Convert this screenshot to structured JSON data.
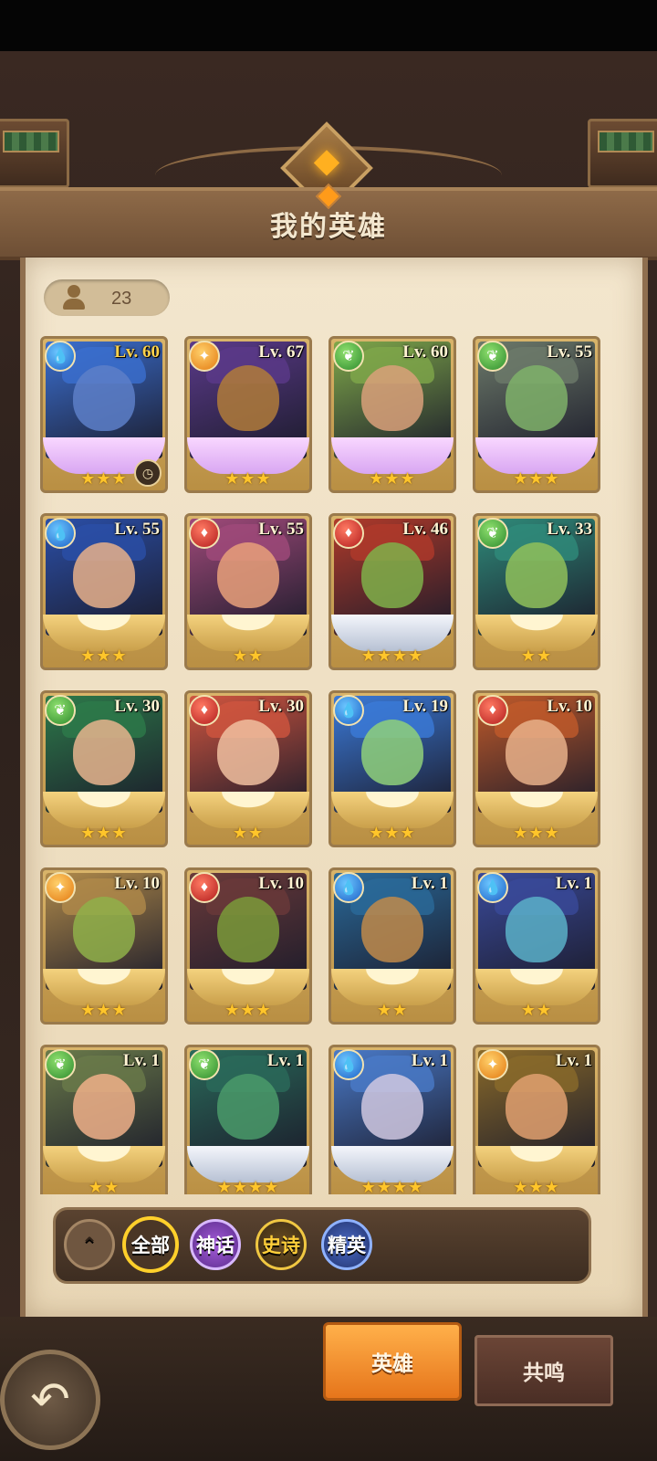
{
  "title": "我的英雄",
  "hero_count": "23",
  "filters": {
    "all": "全部",
    "myth": "神话",
    "epic": "史诗",
    "elite": "精英"
  },
  "tabs": {
    "heroes": "英雄",
    "resonance": "共鸣"
  },
  "heroes": [
    {
      "level": "Lv. 60",
      "element": "water",
      "stars": "★★★",
      "color": "#3b6fd0",
      "skin": "#5d7fc8"
    },
    {
      "level": "Lv. 67",
      "element": "light",
      "stars": "★★★",
      "color": "#5b3a8a",
      "skin": "#b07b3a"
    },
    {
      "level": "Lv. 60",
      "element": "nature",
      "stars": "★★★",
      "color": "#7fa84a",
      "skin": "#d9a07a"
    },
    {
      "level": "Lv. 55",
      "element": "nature",
      "stars": "★★★",
      "color": "#6d7a6a",
      "skin": "#7fb26a"
    },
    {
      "level": "Lv. 55",
      "element": "water",
      "stars": "★★★",
      "color": "#2b4fa8",
      "skin": "#e7b08a"
    },
    {
      "level": "Lv. 55",
      "element": "fire",
      "stars": "★★",
      "color": "#a04a7a",
      "skin": "#e7a07a"
    },
    {
      "level": "Lv. 46",
      "element": "fire",
      "stars": "★★★★",
      "color": "#b03a2a",
      "skin": "#7fb04a"
    },
    {
      "level": "Lv. 33",
      "element": "nature",
      "stars": "★★",
      "color": "#2f8b7a",
      "skin": "#8fbf5a"
    },
    {
      "level": "Lv. 30",
      "element": "nature",
      "stars": "★★★",
      "color": "#2d7a4a",
      "skin": "#e8b48e"
    },
    {
      "level": "Lv. 30",
      "element": "fire",
      "stars": "★★",
      "color": "#d0553f",
      "skin": "#f0c0a0"
    },
    {
      "level": "Lv. 19",
      "element": "water",
      "stars": "★★★",
      "color": "#3b7ad8",
      "skin": "#8fd07a"
    },
    {
      "level": "Lv. 10",
      "element": "fire",
      "stars": "★★★",
      "color": "#c05a2a",
      "skin": "#e8b08a"
    },
    {
      "level": "Lv. 10",
      "element": "light",
      "stars": "★★★",
      "color": "#b08a4a",
      "skin": "#8fb04a"
    },
    {
      "level": "Lv. 10",
      "element": "fire",
      "stars": "★★★",
      "color": "#6a3a3a",
      "skin": "#7a9a3a"
    },
    {
      "level": "Lv. 1",
      "element": "water",
      "stars": "★★",
      "color": "#2a6a9a",
      "skin": "#c08a4a"
    },
    {
      "level": "Lv. 1",
      "element": "water",
      "stars": "★★",
      "color": "#3a4a9a",
      "skin": "#5ab0c8"
    },
    {
      "level": "Lv. 1",
      "element": "nature",
      "stars": "★★",
      "color": "#6a7a4a",
      "skin": "#f0b08a"
    },
    {
      "level": "Lv. 1",
      "element": "nature",
      "stars": "★★★★",
      "color": "#2a6a5a",
      "skin": "#4a9a6a"
    },
    {
      "level": "Lv. 1",
      "element": "water",
      "stars": "★★★★",
      "color": "#4a7ac8",
      "skin": "#d0c8e0"
    },
    {
      "level": "Lv. 1",
      "element": "light",
      "stars": "★★★",
      "color": "#8a6a2a",
      "skin": "#e0a070"
    }
  ],
  "element_icons": {
    "water": "droplet-icon",
    "fire": "flame-gem-icon",
    "nature": "leaf-icon",
    "light": "sun-gem-icon"
  }
}
